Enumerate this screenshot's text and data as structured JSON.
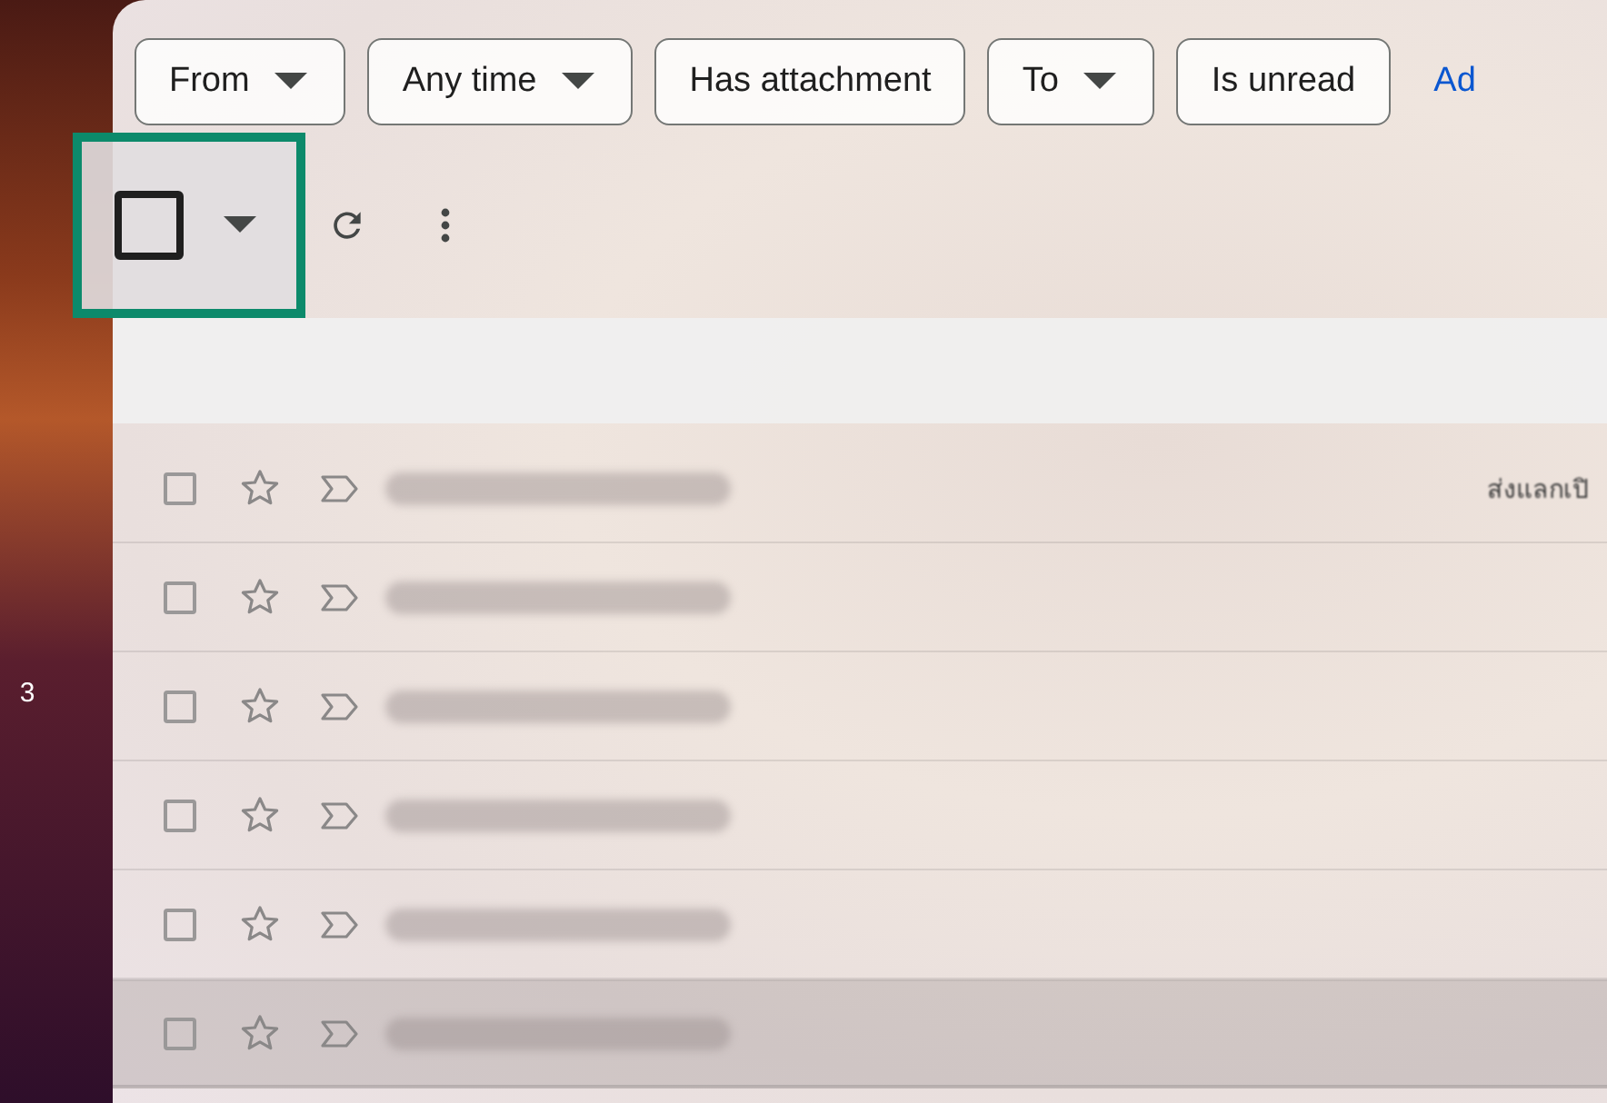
{
  "sidebar": {
    "badge": "3"
  },
  "filters": [
    {
      "label": "From",
      "dropdown": true
    },
    {
      "label": "Any time",
      "dropdown": true
    },
    {
      "label": "Has attachment",
      "dropdown": false
    },
    {
      "label": "To",
      "dropdown": true
    },
    {
      "label": "Is unread",
      "dropdown": false
    }
  ],
  "advanced_link": "Ad",
  "toolbar": {
    "select_all": {
      "checked": false,
      "focused": true
    }
  },
  "messages": [
    {
      "selected": false,
      "starred": false,
      "important": false,
      "hovered": false,
      "snippet": "ส่งแลกเปิ"
    },
    {
      "selected": false,
      "starred": false,
      "important": false,
      "hovered": false
    },
    {
      "selected": false,
      "starred": false,
      "important": false,
      "hovered": false
    },
    {
      "selected": false,
      "starred": false,
      "important": false,
      "hovered": false
    },
    {
      "selected": false,
      "starred": false,
      "important": false,
      "hovered": false
    },
    {
      "selected": false,
      "starred": false,
      "important": false,
      "hovered": true
    }
  ]
}
